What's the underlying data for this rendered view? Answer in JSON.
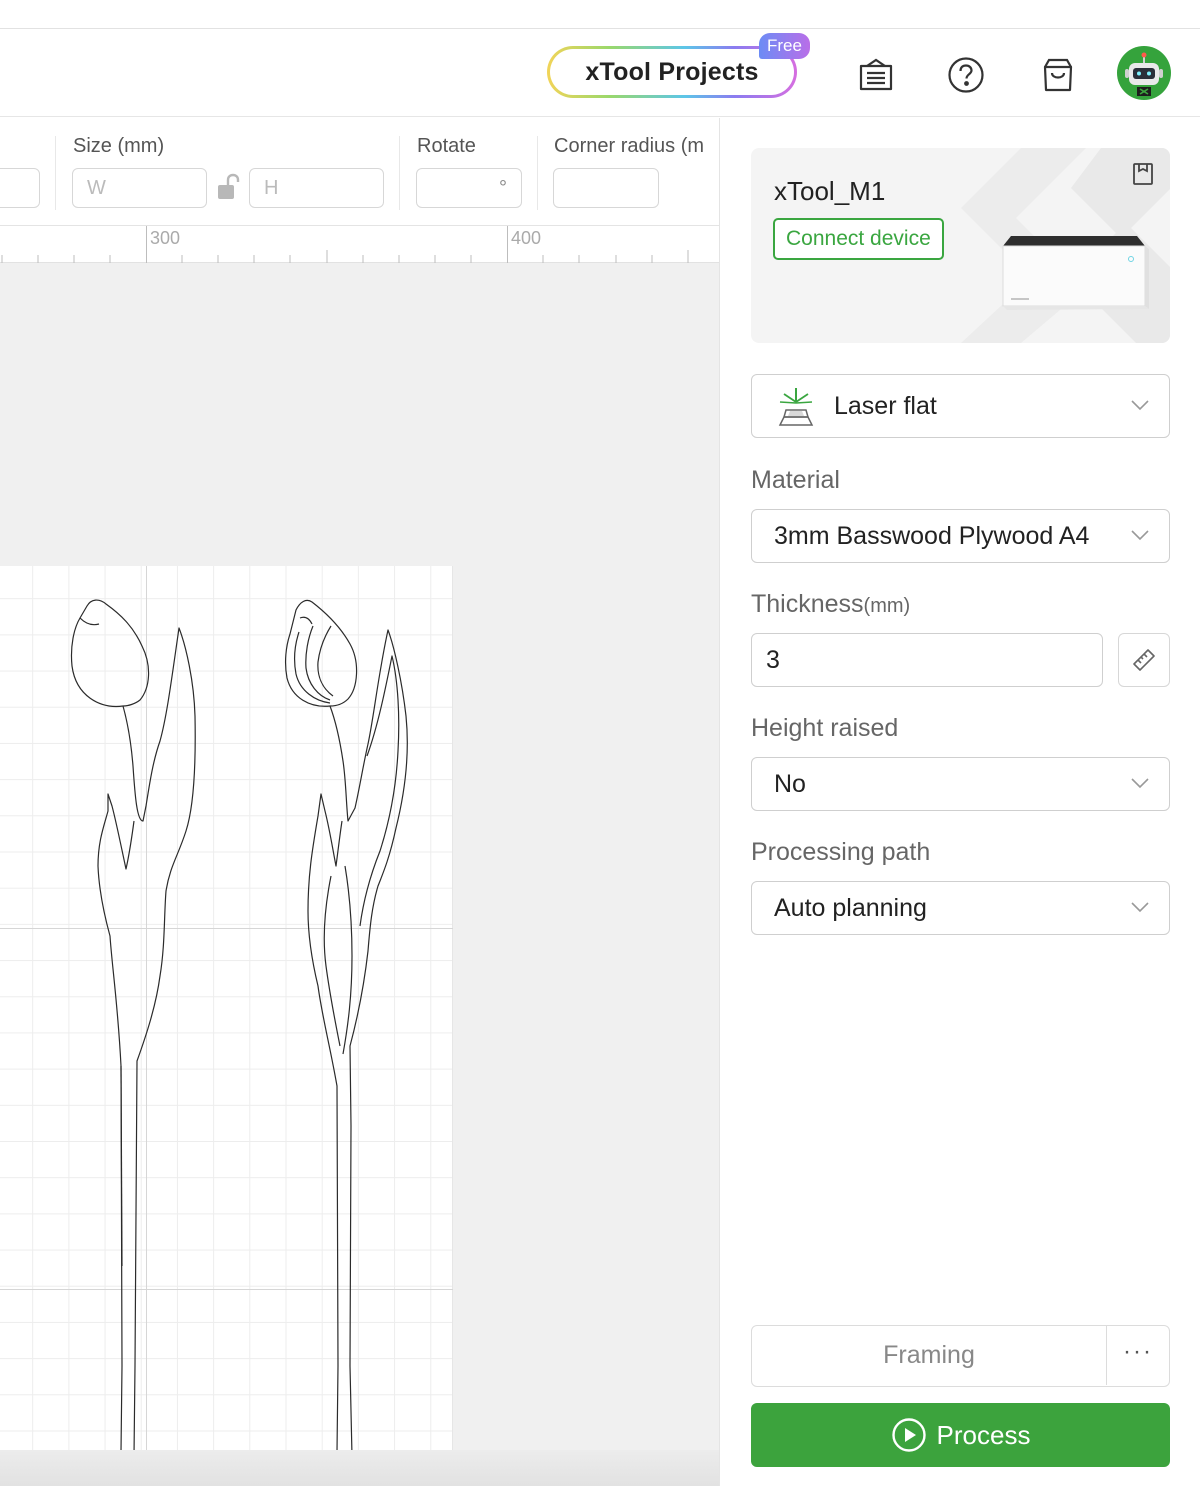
{
  "header": {
    "projects_label": "xTool Projects",
    "free_badge": "Free",
    "icons": [
      "catalog-icon",
      "help-icon",
      "shop-icon",
      "avatar"
    ]
  },
  "toolbar": {
    "size_label": "Size (mm)",
    "width_placeholder": "W",
    "height_placeholder": "H",
    "rotate_label": "Rotate",
    "rotate_unit": "°",
    "corner_label": "Corner radius (m"
  },
  "ruler": {
    "labels": [
      "300",
      "400"
    ]
  },
  "panel": {
    "device_name": "xTool_M1",
    "connect_label": "Connect device",
    "mode_label": "Laser flat",
    "material_label": "Material",
    "material_value": "3mm Basswood Plywood A4",
    "thickness_label": "Thickness",
    "thickness_unit": "(mm)",
    "thickness_value": "3",
    "height_raised_label": "Height raised",
    "height_raised_value": "No",
    "processing_path_label": "Processing path",
    "processing_path_value": "Auto planning",
    "framing_label": "Framing",
    "more_label": "···",
    "process_label": "Process"
  },
  "colors": {
    "accent_green": "#3ca33d",
    "avatar_green": "#35a33c",
    "badge_gradient": [
      "#6c8cf5",
      "#b96ee8"
    ]
  }
}
